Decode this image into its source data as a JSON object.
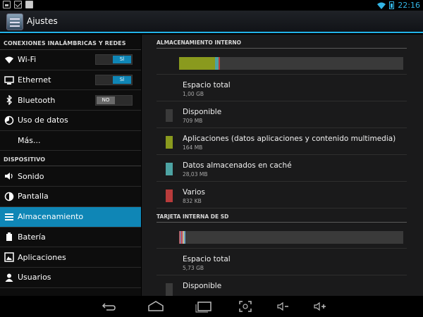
{
  "status_bar": {
    "time": "22:16",
    "icons": [
      "photo-icon",
      "mail-icon",
      "check-icon",
      "wifi-icon",
      "battery-icon"
    ]
  },
  "action_bar": {
    "title": "Ajustes"
  },
  "sidebar": {
    "sections": [
      {
        "header": "CONEXIONES INALÁMBRICAS Y REDES",
        "items": [
          {
            "label": "Wi-Fi",
            "icon": "wifi-icon",
            "toggle": "SÍ",
            "toggle_on": true
          },
          {
            "label": "Ethernet",
            "icon": "ethernet-icon",
            "toggle": "SÍ",
            "toggle_on": true
          },
          {
            "label": "Bluetooth",
            "icon": "bluetooth-icon",
            "toggle": "NO",
            "toggle_on": false
          },
          {
            "label": "Uso de datos",
            "icon": "data-usage-icon"
          },
          {
            "label": "Más...",
            "icon": ""
          }
        ]
      },
      {
        "header": "DISPOSITIVO",
        "items": [
          {
            "label": "Sonido",
            "icon": "sound-icon"
          },
          {
            "label": "Pantalla",
            "icon": "display-icon"
          },
          {
            "label": "Almacenamiento",
            "icon": "storage-icon",
            "selected": true
          },
          {
            "label": "Batería",
            "icon": "battery-icon"
          },
          {
            "label": "Aplicaciones",
            "icon": "apps-icon"
          },
          {
            "label": "Usuarios",
            "icon": "users-icon"
          }
        ]
      }
    ]
  },
  "storage": {
    "internal": {
      "header": "ALMACENAMIENTO INTERNO",
      "usage_bar": [
        {
          "color": "#8a9a1e",
          "fraction": 0.16
        },
        {
          "color": "#4da3a3",
          "fraction": 0.015
        },
        {
          "color": "#b83b3b",
          "fraction": 0.006
        }
      ],
      "items": [
        {
          "title": "Espacio total",
          "value": "1,00 GB",
          "color": ""
        },
        {
          "title": "Disponible",
          "value": "709 MB",
          "color": "#3a3a3a"
        },
        {
          "title": "Aplicaciones (datos aplicaciones y contenido multimedia)",
          "value": "164 MB",
          "color": "#8a9a1e"
        },
        {
          "title": "Datos almacenados en caché",
          "value": "28,03 MB",
          "color": "#4da3a3"
        },
        {
          "title": "Varios",
          "value": "832 KB",
          "color": "#b83b3b"
        }
      ]
    },
    "sd": {
      "header": "TARJETA INTERNA DE SD",
      "usage_bar": [
        {
          "color": "#b85a5a",
          "fraction": 0.004
        },
        {
          "color": "#8a7a9e",
          "fraction": 0.004
        },
        {
          "color": "#c4c4c4",
          "fraction": 0.003
        },
        {
          "color": "#cc4b4b",
          "fraction": 0.004
        },
        {
          "color": "#8fb0d8",
          "fraction": 0.005
        },
        {
          "color": "#e8c15b",
          "fraction": 0.003
        },
        {
          "color": "#6aa0c8",
          "fraction": 0.004
        }
      ],
      "items": [
        {
          "title": "Espacio total",
          "value": "5,73 GB",
          "color": ""
        },
        {
          "title": "Disponible",
          "value": "",
          "color": "#3a3a3a"
        }
      ]
    }
  },
  "nav_bar": {
    "buttons": [
      "back-icon",
      "home-icon",
      "recent-apps-icon",
      "screenshot-icon",
      "volume-down-icon",
      "volume-up-icon"
    ]
  }
}
